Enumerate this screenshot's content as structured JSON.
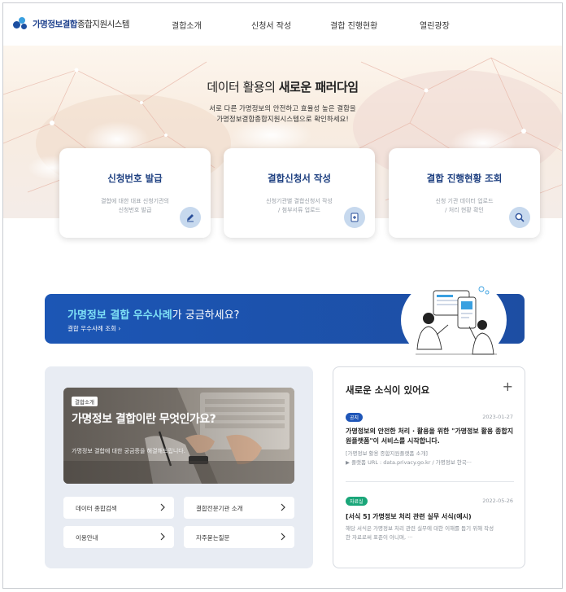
{
  "header": {
    "logo_main": "가명정보결합",
    "logo_sub": "종합지원시스템",
    "nav": [
      "결합소개",
      "신청서 작성",
      "결합 진행현황",
      "열린광장"
    ]
  },
  "hero": {
    "title_plain": "데이터 활용의 ",
    "title_bold": "새로운 패러다임",
    "subtitle_line1": "서로 다른 가명정보의 안전하고 효율성 높은 결합을",
    "subtitle_line2": "가명정보결합종합지원시스템으로 확인하세요!"
  },
  "cards": [
    {
      "title": "신청번호 발급",
      "desc1": "결합에 대한 대표 신청기관의",
      "desc2": "신청번호 발급",
      "icon": "pencil-icon"
    },
    {
      "title": "결합신청서 작성",
      "desc1": "신청기관별 결합신청서 작성",
      "desc2": "/ 첨부서류 업로드",
      "icon": "document-plus-icon"
    },
    {
      "title": "결합 진행현황 조회",
      "desc1": "신청 기관 데이터 업로드",
      "desc2": "/ 처리 현황 확인",
      "icon": "search-icon"
    }
  ],
  "banner": {
    "title_highlight": "가명정보 결합 우수사례",
    "title_rest": "가 궁금하세요?",
    "link": "결합 우수사례 조회"
  },
  "feature": {
    "badge": "결합소개",
    "title": "가명정보 결합이란 무엇인가요?",
    "desc": "가명정보 결합에 대한 궁금증을 해결해드립니다."
  },
  "quick_links": [
    "데이터 종합검색",
    "결합전문기관 소개",
    "이용안내",
    "자주묻는질문"
  ],
  "news": {
    "title": "새로운 소식이 있어요",
    "items": [
      {
        "badge": "공지",
        "date": "2023-01-27",
        "headline": "가명정보의 안전한 처리 · 활용을 위한 \"가명정보 활용 종합지원플랫폼\"이 서비스를 시작합니다.",
        "body1": "[가명정보 활용 종합지원플랫폼 소개]",
        "body2": "▶ 플랫폼 URL : data.privacy.go.kr / 가명정보 한국···"
      },
      {
        "badge": "자료실",
        "date": "2022-05-26",
        "headline": "[서식 5] 가명정보 처리 관련 실무 서식(예시)",
        "body1": "해당 서식은 가명정보 처리 관련 실무에 대한 이해를 돕기 위해 작성",
        "body2": "한 자료로써 표준이 아니며, ···"
      }
    ]
  },
  "colors": {
    "brand": "#1c3f8c",
    "banner": "#1c56b5",
    "highlight": "#7ee0f5",
    "notice_badge": "#1f56b8",
    "data_badge": "#1aa679"
  }
}
